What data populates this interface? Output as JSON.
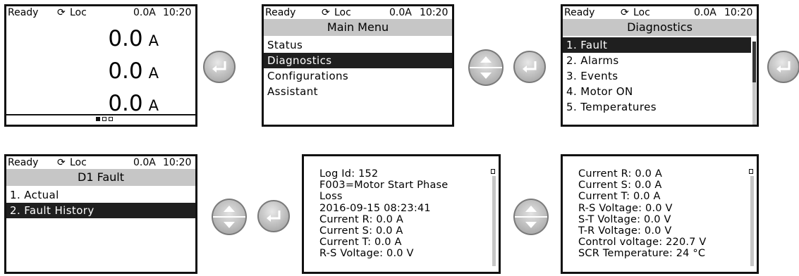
{
  "status": {
    "state": "Ready",
    "mode_icon": "rotate-arrow-icon",
    "mode": "Loc",
    "current": "0.0A",
    "time": "10:20"
  },
  "panel1": {
    "readings": [
      {
        "value": "0.0",
        "unit": "A"
      },
      {
        "value": "0.0",
        "unit": "A"
      },
      {
        "value": "0.0",
        "unit": "A"
      }
    ],
    "page_indicator": {
      "pages": 3,
      "active": 1
    }
  },
  "panel2": {
    "title": "Main Menu",
    "items": [
      "Status",
      "Diagnostics",
      "Configurations",
      "Assistant"
    ],
    "selected_index": 1
  },
  "panel3": {
    "title": "Diagnostics",
    "items": [
      "1. Fault",
      "2. Alarms",
      "3. Events",
      "4. Motor ON",
      "5. Temperatures"
    ],
    "selected_index": 0
  },
  "panel4": {
    "title": "D1 Fault",
    "items": [
      "1. Actual",
      "2. Fault History"
    ],
    "selected_index": 1
  },
  "panel5": {
    "lines": [
      "Log Id: 152",
      "F003=Motor Start Phase",
      "Loss",
      "2016-09-15 08:23:41",
      "Current R: 0.0 A",
      "Current S: 0.0 A",
      "Current T: 0.0 A",
      "R-S Voltage: 0.0 V"
    ]
  },
  "panel6": {
    "lines": [
      "Current R: 0.0 A",
      "Current S: 0.0 A",
      "Current T: 0.0 A",
      "R-S Voltage: 0.0 V",
      "S-T Voltage: 0.0 V",
      "T-R Voltage: 0.0 V",
      "Control voltage: 220.7 V",
      "SCR Temperature: 24 °C"
    ]
  },
  "buttons": {
    "enter_icon": "enter-return-icon",
    "scroll_icon": "up-down-arrows-icon"
  },
  "colors": {
    "selection": "#1f1f1f",
    "title_bar": "#c6c6c6",
    "button": "#bdbdbd"
  }
}
